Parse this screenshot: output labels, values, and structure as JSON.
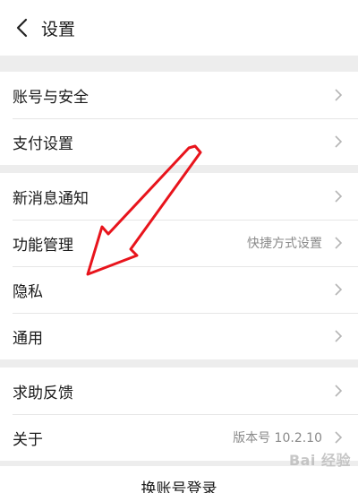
{
  "header": {
    "title": "设置",
    "back_icon": "chevron-left-icon"
  },
  "groups": [
    {
      "items": [
        {
          "label": "账号与安全"
        },
        {
          "label": "支付设置"
        }
      ]
    },
    {
      "items": [
        {
          "label": "新消息通知"
        },
        {
          "label": "功能管理",
          "value": "快捷方式设置"
        },
        {
          "label": "隐私"
        },
        {
          "label": "通用"
        }
      ]
    },
    {
      "items": [
        {
          "label": "求助反馈"
        },
        {
          "label": "关于",
          "value": "版本号 10.2.10"
        }
      ]
    }
  ],
  "logout": {
    "label": "换账号登录"
  },
  "annotation": {
    "type": "red-arrow",
    "color": "#e8141c"
  },
  "watermark": {
    "text": "Bai 经验"
  }
}
